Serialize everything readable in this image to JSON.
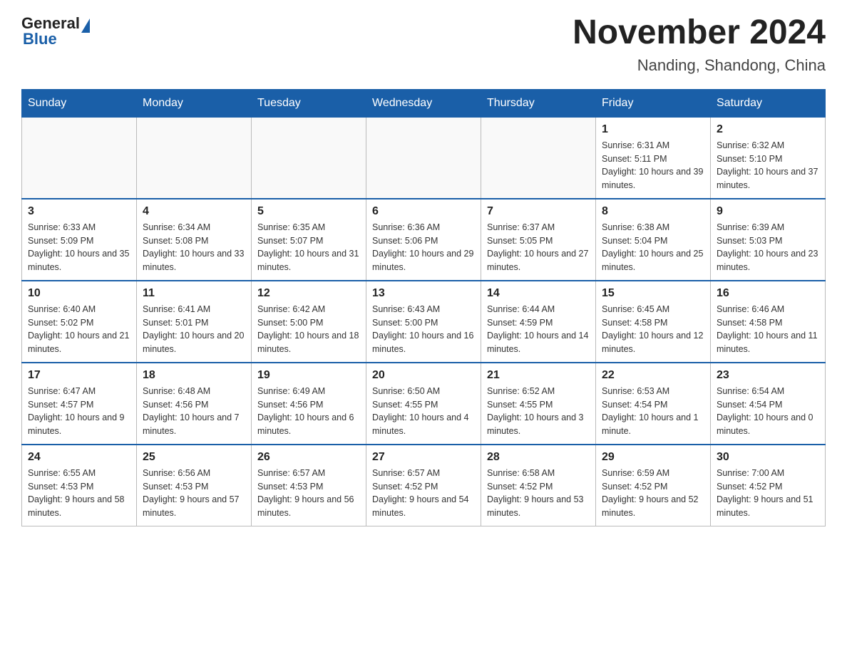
{
  "header": {
    "logo_general": "General",
    "logo_blue": "Blue",
    "title": "November 2024",
    "subtitle": "Nanding, Shandong, China"
  },
  "calendar": {
    "days_of_week": [
      "Sunday",
      "Monday",
      "Tuesday",
      "Wednesday",
      "Thursday",
      "Friday",
      "Saturday"
    ],
    "weeks": [
      [
        {
          "day": "",
          "info": ""
        },
        {
          "day": "",
          "info": ""
        },
        {
          "day": "",
          "info": ""
        },
        {
          "day": "",
          "info": ""
        },
        {
          "day": "",
          "info": ""
        },
        {
          "day": "1",
          "info": "Sunrise: 6:31 AM\nSunset: 5:11 PM\nDaylight: 10 hours and 39 minutes."
        },
        {
          "day": "2",
          "info": "Sunrise: 6:32 AM\nSunset: 5:10 PM\nDaylight: 10 hours and 37 minutes."
        }
      ],
      [
        {
          "day": "3",
          "info": "Sunrise: 6:33 AM\nSunset: 5:09 PM\nDaylight: 10 hours and 35 minutes."
        },
        {
          "day": "4",
          "info": "Sunrise: 6:34 AM\nSunset: 5:08 PM\nDaylight: 10 hours and 33 minutes."
        },
        {
          "day": "5",
          "info": "Sunrise: 6:35 AM\nSunset: 5:07 PM\nDaylight: 10 hours and 31 minutes."
        },
        {
          "day": "6",
          "info": "Sunrise: 6:36 AM\nSunset: 5:06 PM\nDaylight: 10 hours and 29 minutes."
        },
        {
          "day": "7",
          "info": "Sunrise: 6:37 AM\nSunset: 5:05 PM\nDaylight: 10 hours and 27 minutes."
        },
        {
          "day": "8",
          "info": "Sunrise: 6:38 AM\nSunset: 5:04 PM\nDaylight: 10 hours and 25 minutes."
        },
        {
          "day": "9",
          "info": "Sunrise: 6:39 AM\nSunset: 5:03 PM\nDaylight: 10 hours and 23 minutes."
        }
      ],
      [
        {
          "day": "10",
          "info": "Sunrise: 6:40 AM\nSunset: 5:02 PM\nDaylight: 10 hours and 21 minutes."
        },
        {
          "day": "11",
          "info": "Sunrise: 6:41 AM\nSunset: 5:01 PM\nDaylight: 10 hours and 20 minutes."
        },
        {
          "day": "12",
          "info": "Sunrise: 6:42 AM\nSunset: 5:00 PM\nDaylight: 10 hours and 18 minutes."
        },
        {
          "day": "13",
          "info": "Sunrise: 6:43 AM\nSunset: 5:00 PM\nDaylight: 10 hours and 16 minutes."
        },
        {
          "day": "14",
          "info": "Sunrise: 6:44 AM\nSunset: 4:59 PM\nDaylight: 10 hours and 14 minutes."
        },
        {
          "day": "15",
          "info": "Sunrise: 6:45 AM\nSunset: 4:58 PM\nDaylight: 10 hours and 12 minutes."
        },
        {
          "day": "16",
          "info": "Sunrise: 6:46 AM\nSunset: 4:58 PM\nDaylight: 10 hours and 11 minutes."
        }
      ],
      [
        {
          "day": "17",
          "info": "Sunrise: 6:47 AM\nSunset: 4:57 PM\nDaylight: 10 hours and 9 minutes."
        },
        {
          "day": "18",
          "info": "Sunrise: 6:48 AM\nSunset: 4:56 PM\nDaylight: 10 hours and 7 minutes."
        },
        {
          "day": "19",
          "info": "Sunrise: 6:49 AM\nSunset: 4:56 PM\nDaylight: 10 hours and 6 minutes."
        },
        {
          "day": "20",
          "info": "Sunrise: 6:50 AM\nSunset: 4:55 PM\nDaylight: 10 hours and 4 minutes."
        },
        {
          "day": "21",
          "info": "Sunrise: 6:52 AM\nSunset: 4:55 PM\nDaylight: 10 hours and 3 minutes."
        },
        {
          "day": "22",
          "info": "Sunrise: 6:53 AM\nSunset: 4:54 PM\nDaylight: 10 hours and 1 minute."
        },
        {
          "day": "23",
          "info": "Sunrise: 6:54 AM\nSunset: 4:54 PM\nDaylight: 10 hours and 0 minutes."
        }
      ],
      [
        {
          "day": "24",
          "info": "Sunrise: 6:55 AM\nSunset: 4:53 PM\nDaylight: 9 hours and 58 minutes."
        },
        {
          "day": "25",
          "info": "Sunrise: 6:56 AM\nSunset: 4:53 PM\nDaylight: 9 hours and 57 minutes."
        },
        {
          "day": "26",
          "info": "Sunrise: 6:57 AM\nSunset: 4:53 PM\nDaylight: 9 hours and 56 minutes."
        },
        {
          "day": "27",
          "info": "Sunrise: 6:57 AM\nSunset: 4:52 PM\nDaylight: 9 hours and 54 minutes."
        },
        {
          "day": "28",
          "info": "Sunrise: 6:58 AM\nSunset: 4:52 PM\nDaylight: 9 hours and 53 minutes."
        },
        {
          "day": "29",
          "info": "Sunrise: 6:59 AM\nSunset: 4:52 PM\nDaylight: 9 hours and 52 minutes."
        },
        {
          "day": "30",
          "info": "Sunrise: 7:00 AM\nSunset: 4:52 PM\nDaylight: 9 hours and 51 minutes."
        }
      ]
    ]
  }
}
